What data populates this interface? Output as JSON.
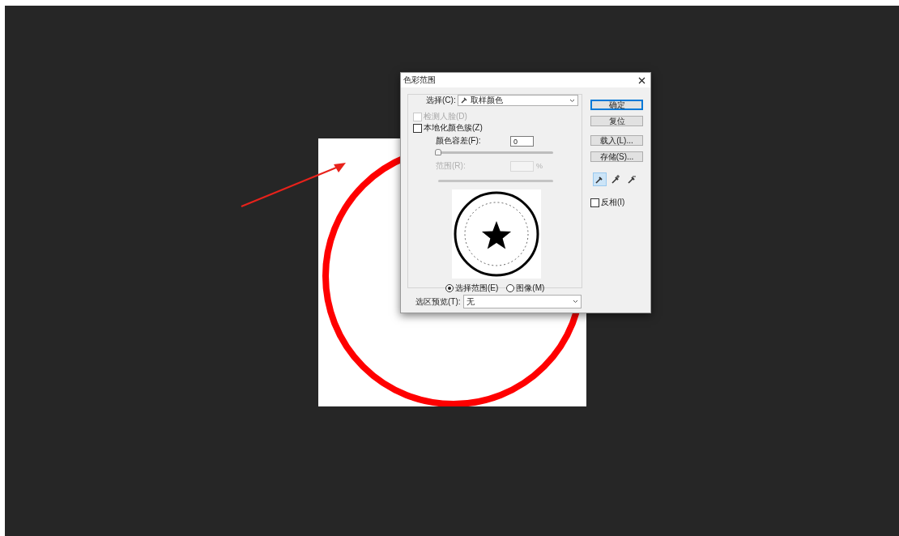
{
  "dialog": {
    "title": "色彩范围",
    "select": {
      "label": "选择(C):",
      "value": "取样颜色"
    },
    "options": [
      {
        "label": "检测人脸(D)",
        "checked": false,
        "disabled": true
      },
      {
        "label": "本地化颜色簇(Z)",
        "checked": false,
        "disabled": false
      }
    ],
    "fuzziness": {
      "label": "颜色容差(F):",
      "value": "0",
      "level": 0
    },
    "range": {
      "label": "范围(R):",
      "unit": "%",
      "disabled": true
    },
    "view_modes": [
      {
        "label": "选择范围(E)",
        "selected": true
      },
      {
        "label": "图像(M)",
        "selected": false
      }
    ],
    "selection_preview": {
      "label": "选区预览(T):",
      "value": "无"
    },
    "buttons": [
      {
        "label": "确定",
        "default": true
      },
      {
        "label": "复位",
        "default": false
      },
      {
        "label": "载入(L)...",
        "default": false
      },
      {
        "label": "存储(S)...",
        "default": false
      }
    ],
    "eyedroppers": [
      {
        "kind": "sample",
        "selected": true
      },
      {
        "kind": "add",
        "selected": false
      },
      {
        "kind": "subtract",
        "selected": false
      }
    ],
    "invert": {
      "label": "反相(I)",
      "checked": false
    }
  }
}
